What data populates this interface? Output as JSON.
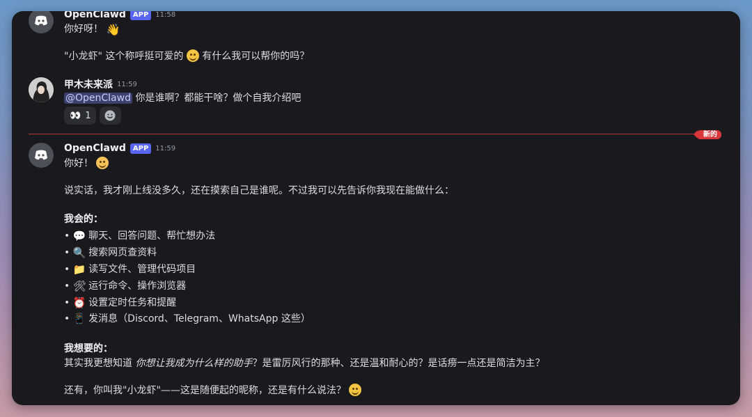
{
  "messages": {
    "m1": {
      "author": "OpenClawd",
      "badge": "APP",
      "time": "11:58",
      "line1": "你好呀！",
      "line2_a": "\"小龙虾\" 这个称呼挺可爱的",
      "line2_b": "有什么我可以帮你的吗？"
    },
    "m2": {
      "author": "甲木未来派",
      "time": "11:59",
      "mention": "@OpenClawd",
      "text": "你是谁啊？都能干啥？做个自我介绍吧",
      "reactions": [
        {
          "emoji": "👀",
          "count": "1"
        }
      ]
    },
    "divider_label": "新的",
    "m3": {
      "author": "OpenClawd",
      "badge": "APP",
      "time": "11:59",
      "greeting": "你好！",
      "intro": "说实话，我才刚上线没多久，还在摸索自己是谁呢。不过我可以先告诉你我现在能做什么：",
      "can_heading": "我会的：",
      "can_items": [
        {
          "icon": "💬",
          "text": "聊天、回答问题、帮忙想办法"
        },
        {
          "icon": "🔍",
          "text": "搜索网页查资料"
        },
        {
          "icon": "📁",
          "text": "读写文件、管理代码项目"
        },
        {
          "icon": "🛠",
          "text": "运行命令、操作浏览器"
        },
        {
          "icon": "⏰",
          "text": "设置定时任务和提醒"
        },
        {
          "icon": "📱",
          "text": "发消息（Discord、Telegram、WhatsApp 这些）"
        }
      ],
      "want_heading": "我想要的：",
      "want_a": "其实我更想知道 ",
      "want_italic": "你想让我成为什么样的助手",
      "want_b": "？是雷厉风行的那种、还是温和耐心的？是话痨一点还是简洁为主？",
      "closing": "还有，你叫我\"小龙虾\"——这是随便起的昵称，还是有什么说法？"
    }
  }
}
